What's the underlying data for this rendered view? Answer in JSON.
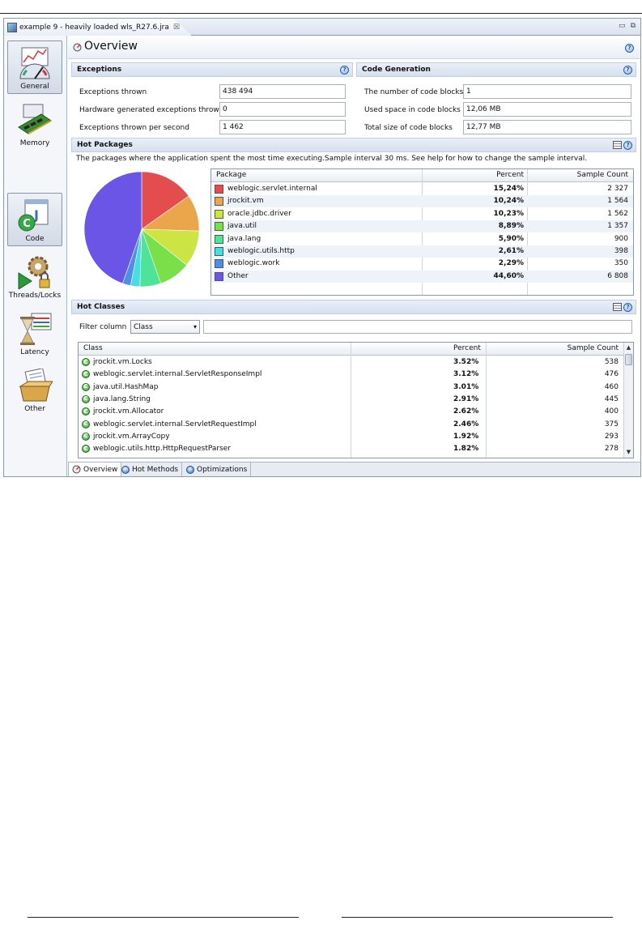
{
  "editor": {
    "tab_title": "example 9 - heavily loaded wls_R27.6.jra",
    "close_glyph": "☒",
    "minimize_glyph": "▭",
    "maximize_glyph": "⧉"
  },
  "nav": {
    "items": [
      {
        "label": "General"
      },
      {
        "label": "Memory"
      },
      {
        "label": "Code"
      },
      {
        "label": "Threads/Locks"
      },
      {
        "label": "Latency"
      },
      {
        "label": "Other"
      }
    ]
  },
  "page": {
    "title": "Overview",
    "help": "?"
  },
  "exceptions": {
    "title": "Exceptions",
    "rows": [
      {
        "label": "Exceptions thrown",
        "value": "438 494"
      },
      {
        "label": "Hardware generated exceptions thrown",
        "value": "0"
      },
      {
        "label": "Exceptions thrown per second",
        "value": "1 462"
      }
    ]
  },
  "codegen": {
    "title": "Code Generation",
    "rows": [
      {
        "label": "The number of code blocks",
        "value": "1"
      },
      {
        "label": "Used space in code blocks",
        "value": "12,06 MB"
      },
      {
        "label": "Total size of code blocks",
        "value": "12,77 MB"
      }
    ]
  },
  "hot_packages": {
    "title": "Hot Packages",
    "description": "The packages where the application spent the most time executing.Sample interval 30 ms. See help for how to change the sample interval.",
    "columns": [
      "Package",
      "Percent",
      "Sample Count"
    ],
    "rows": [
      {
        "name": "weblogic.servlet.internal",
        "percent": "15,24%",
        "count": "2 327",
        "color": "#e44d4d"
      },
      {
        "name": "jrockit.vm",
        "percent": "10,24%",
        "count": "1 564",
        "color": "#eba54a"
      },
      {
        "name": "oracle.jdbc.driver",
        "percent": "10,23%",
        "count": "1 562",
        "color": "#cde445"
      },
      {
        "name": "java.util",
        "percent": "8,89%",
        "count": "1 357",
        "color": "#79e04a"
      },
      {
        "name": "java.lang",
        "percent": "5,90%",
        "count": "900",
        "color": "#4fe39a"
      },
      {
        "name": "weblogic.utils.http",
        "percent": "2,61%",
        "count": "398",
        "color": "#49dce0"
      },
      {
        "name": "weblogic.work",
        "percent": "2,29%",
        "count": "350",
        "color": "#4d8fe6"
      },
      {
        "name": "Other",
        "percent": "44,60%",
        "count": "6 808",
        "color": "#6a55e6"
      }
    ]
  },
  "chart_data": {
    "type": "pie",
    "categories": [
      "weblogic.servlet.internal",
      "jrockit.vm",
      "oracle.jdbc.driver",
      "java.util",
      "java.lang",
      "weblogic.utils.http",
      "weblogic.work",
      "Other"
    ],
    "values": [
      15.24,
      10.24,
      10.23,
      8.89,
      5.9,
      2.61,
      2.29,
      44.6
    ],
    "colors": [
      "#e44d4d",
      "#eba54a",
      "#cde445",
      "#79e04a",
      "#4fe39a",
      "#49dce0",
      "#4d8fe6",
      "#6a55e6"
    ]
  },
  "hot_classes": {
    "title": "Hot Classes",
    "filter_label": "Filter column",
    "filter_value": "Class",
    "filter_text": "",
    "columns": [
      "Class",
      "Percent",
      "Sample Count"
    ],
    "rows": [
      {
        "name": "jrockit.vm.Locks",
        "percent": "3.52%",
        "count": "538"
      },
      {
        "name": "weblogic.servlet.internal.ServletResponseImpl",
        "percent": "3.12%",
        "count": "476"
      },
      {
        "name": "java.util.HashMap",
        "percent": "3.01%",
        "count": "460"
      },
      {
        "name": "java.lang.String",
        "percent": "2.91%",
        "count": "445"
      },
      {
        "name": "jrockit.vm.Allocator",
        "percent": "2.62%",
        "count": "400"
      },
      {
        "name": "weblogic.servlet.internal.ServletRequestImpl",
        "percent": "2.46%",
        "count": "375"
      },
      {
        "name": "jrockit.vm.ArrayCopy",
        "percent": "1.92%",
        "count": "293"
      },
      {
        "name": "weblogic.utils.http.HttpRequestParser",
        "percent": "1.82%",
        "count": "278"
      }
    ]
  },
  "bottom_tabs": [
    {
      "label": "Overview"
    },
    {
      "label": "Hot Methods"
    },
    {
      "label": "Optimizations"
    }
  ]
}
